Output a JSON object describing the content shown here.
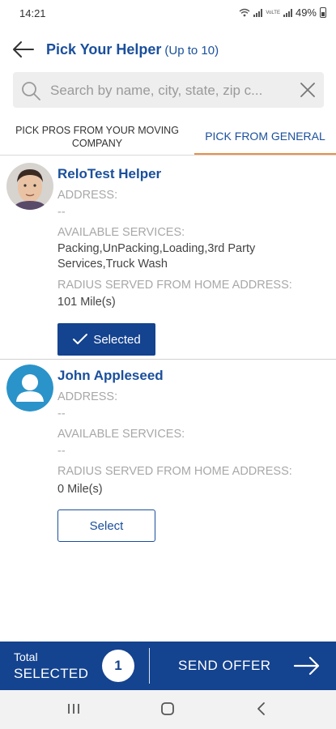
{
  "status_bar": {
    "time": "14:21",
    "battery": "49%",
    "network": "VoLTE"
  },
  "header": {
    "title": "Pick Your Helper",
    "subtitle": "(Up to 10)"
  },
  "search": {
    "placeholder": "Search by name, city, state, zip c..."
  },
  "tabs": [
    {
      "label": "PICK PROS FROM YOUR MOVING COMPANY",
      "active": false
    },
    {
      "label": "PICK FROM GENERAL",
      "active": true
    }
  ],
  "helpers": [
    {
      "name": "ReloTest Helper",
      "address_label": "ADDRESS:",
      "address": "--",
      "services_label": "AVAILABLE SERVICES:",
      "services": "Packing,UnPacking,Loading,3rd Party Services,Truck Wash",
      "radius_label": "RADIUS SERVED FROM HOME ADDRESS:",
      "radius": "101 Mile(s)",
      "button_label": "Selected",
      "selected": true
    },
    {
      "name": "John Appleseed",
      "address_label": "ADDRESS:",
      "address": "--",
      "services_label": "AVAILABLE SERVICES:",
      "services": "--",
      "radius_label": "RADIUS SERVED FROM HOME ADDRESS:",
      "radius": "0 Mile(s)",
      "button_label": "Select",
      "selected": false
    }
  ],
  "footer": {
    "total_label": "Total",
    "selected_label": "SELECTED",
    "count": "1",
    "send_label": "SEND OFFER"
  },
  "colors": {
    "primary": "#14438f",
    "title": "#1a4f9c",
    "tab_underline": "#e8904a",
    "avatar_bg": "#2a93c9"
  }
}
